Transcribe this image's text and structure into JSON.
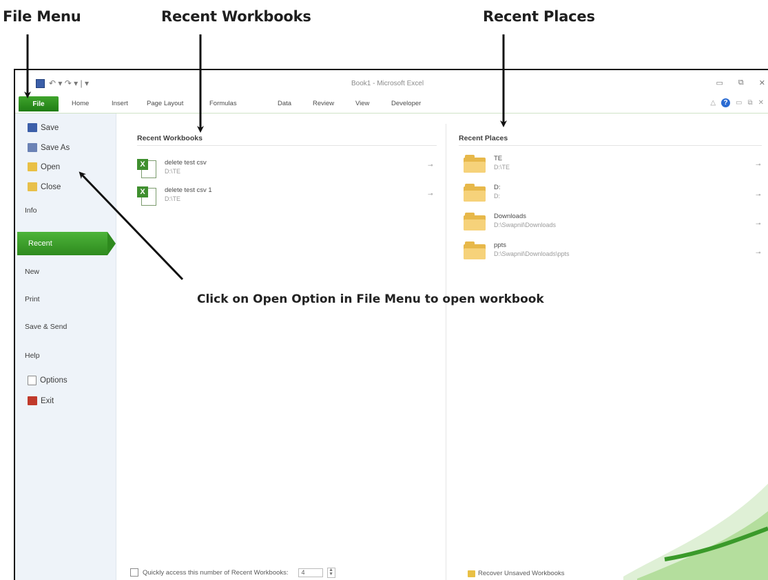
{
  "annotations": {
    "file_menu": "File Menu",
    "recent_workbooks": "Recent Workbooks",
    "recent_places": "Recent Places",
    "callout": "Click on Open Option in File Menu to open workbook"
  },
  "window": {
    "title": "Book1 - Microsoft Excel",
    "qat_text": "↶ ▾ ↷ ▾ | ▾",
    "controls": [
      "▭",
      "⧉",
      "✕"
    ]
  },
  "ribbon": {
    "file_tab": "File",
    "tabs": [
      "Home",
      "Insert",
      "Page Layout",
      "Formulas",
      "Data",
      "Review",
      "View",
      "Developer"
    ],
    "right_icons": [
      "△",
      "?",
      "▭",
      "⧉",
      "✕"
    ]
  },
  "nav": {
    "items": [
      {
        "label": "Save",
        "icon": "save-icon"
      },
      {
        "label": "Save As",
        "icon": "save-as-icon"
      },
      {
        "label": "Open",
        "icon": "open-folder-icon"
      },
      {
        "label": "Close",
        "icon": "close-folder-icon"
      }
    ],
    "info": "Info",
    "recent": "Recent",
    "new": "New",
    "print": "Print",
    "save_send": "Save & Send",
    "help": "Help",
    "options": "Options",
    "exit": "Exit"
  },
  "recent_workbooks": {
    "heading": "Recent Workbooks",
    "items": [
      {
        "name": "delete test csv",
        "path": "D:\\TE"
      },
      {
        "name": "delete test csv 1",
        "path": "D:\\TE"
      }
    ]
  },
  "recent_places": {
    "heading": "Recent Places",
    "items": [
      {
        "name": "TE",
        "path": "D:\\TE"
      },
      {
        "name": "D:",
        "path": "D:"
      },
      {
        "name": "Downloads",
        "path": "D:\\Swapnil\\Downloads"
      },
      {
        "name": "ppts",
        "path": "D:\\Swapnil\\Downloads\\ppts"
      }
    ]
  },
  "bottom": {
    "quick_access_label": "Quickly access this number of Recent Workbooks:",
    "quick_access_value": "4",
    "recover_label": "Recover Unsaved Workbooks"
  },
  "colors": {
    "file_green": "#2e8a1e",
    "nav_bg": "#eef3f9",
    "folder_yellow": "#f6d27a"
  }
}
